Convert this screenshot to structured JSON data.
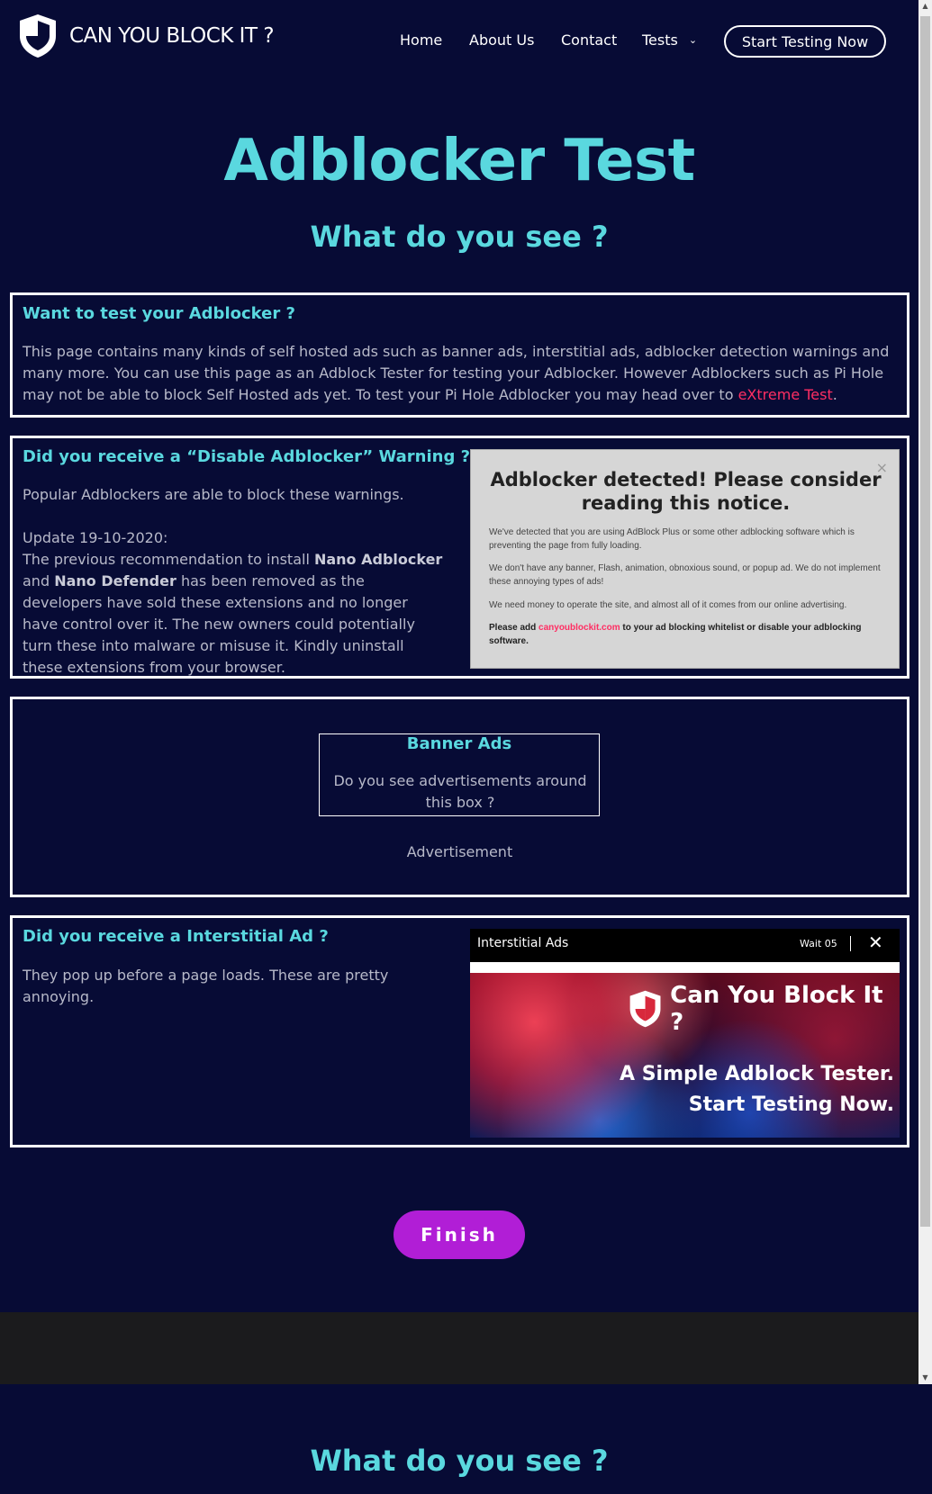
{
  "header": {
    "logo_text": "CAN YOU BLOCK IT ?",
    "nav": [
      {
        "label": "Home"
      },
      {
        "label": "About Us"
      },
      {
        "label": "Contact"
      },
      {
        "label": "Tests"
      }
    ],
    "cta_label": "Start Testing Now"
  },
  "hero": {
    "title": "Adblocker Test",
    "subtitle": "What do you see ?"
  },
  "section1": {
    "title": "Want to test your Adblocker ?",
    "text_before_link": "This page contains many kinds of self hosted ads such as banner ads, interstitial ads, adblocker detection warnings and many more. You can use this page as an Adblock Tester for testing your Adblocker. However Adblockers such as Pi Hole may not be able to block Self Hosted ads yet. To test your Pi Hole Adblocker you may head over to ",
    "link_text": "eXtreme Test",
    "text_after_link": "."
  },
  "section2": {
    "title": "Did you receive a “Disable Adblocker” Warning ?",
    "intro": "Popular Adblockers are able to block these warnings.",
    "update_label": "Update 19-10-2020:",
    "update_p1": "The previous recommendation to install ",
    "bold1": "Nano Adblocker",
    "update_p2": " and ",
    "bold2": "Nano Defender",
    "update_p3": " has been removed as the developers have sold these extensions and no longer have control over it. The new owners could potentially turn these into malware or misuse it. Kindly uninstall these extensions from your browser.",
    "notice": {
      "title": "Adblocker detected! Please consider reading this notice.",
      "close": "×",
      "p1": "We've detected that you are using AdBlock Plus or some other adblocking software which is preventing the page from fully loading.",
      "p2": "We don't have any banner, Flash, animation, obnoxious sound, or popup ad. We do not implement these annoying types of ads!",
      "p3": "We need money to operate the site, and almost all of it comes from our online advertising.",
      "p4_before": "Please add ",
      "p4_link": "canyoublockit.com",
      "p4_after": " to your ad blocking whitelist or disable your adblocking software."
    }
  },
  "section3": {
    "banner_title": "Banner Ads",
    "banner_text": "Do you see advertisements around this box ?",
    "ad_label": "Advertisement"
  },
  "section4": {
    "title": "Did you receive a Interstitial Ad ?",
    "text": "They pop up before a page loads. These are pretty annoying.",
    "interstitial": {
      "bar_title": "Interstitial Ads",
      "wait": "Wait 05",
      "close": "✕",
      "brand": "Can You Block It ?",
      "line1": "A Simple Adblock Tester.",
      "line2": "Start Testing Now."
    }
  },
  "finish_label": "Finish",
  "colors": {
    "background": "#070b35",
    "accent": "#5ad8df",
    "finish": "#b11ed6",
    "link": "#ff2e63"
  }
}
